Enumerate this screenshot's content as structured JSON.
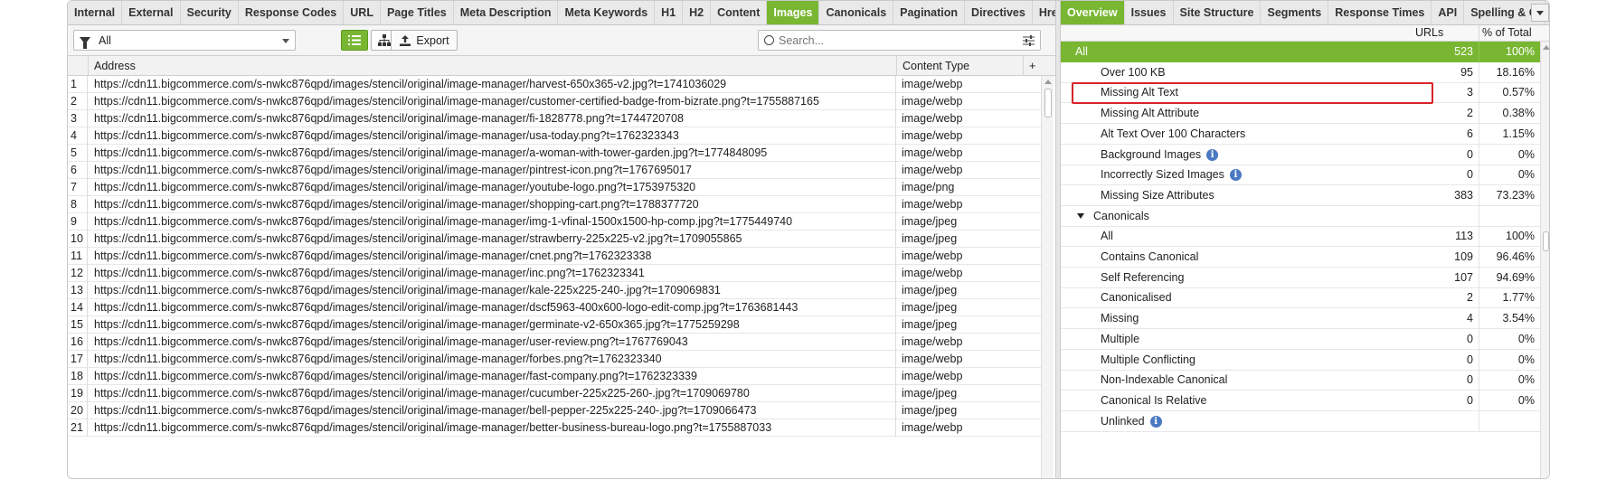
{
  "colors": {
    "accent": "#79b733",
    "highlight": "#d8232a",
    "info": "#4a78c2"
  },
  "left_tabs": [
    "Internal",
    "External",
    "Security",
    "Response Codes",
    "URL",
    "Page Titles",
    "Meta Description",
    "Meta Keywords",
    "H1",
    "H2",
    "Content",
    "Images",
    "Canonicals",
    "Pagination",
    "Directives",
    "Href"
  ],
  "left_active_tab": "Images",
  "toolbar": {
    "filter_value": "All",
    "export_label": "Export",
    "search_placeholder": "Search..."
  },
  "grid": {
    "columns": [
      "Address",
      "Content Type",
      "+"
    ],
    "rows": [
      {
        "n": "1",
        "address": "https://cdn11.bigcommerce.com/s-nwkc876qpd/images/stencil/original/image-manager/harvest-650x365-v2.jpg?t=1741036029",
        "type": "image/webp"
      },
      {
        "n": "2",
        "address": "https://cdn11.bigcommerce.com/s-nwkc876qpd/images/stencil/original/image-manager/customer-certified-badge-from-bizrate.png?t=1755887165",
        "type": "image/webp"
      },
      {
        "n": "3",
        "address": "https://cdn11.bigcommerce.com/s-nwkc876qpd/images/stencil/original/image-manager/fi-1828778.png?t=1744720708",
        "type": "image/webp"
      },
      {
        "n": "4",
        "address": "https://cdn11.bigcommerce.com/s-nwkc876qpd/images/stencil/original/image-manager/usa-today.png?t=1762323343",
        "type": "image/webp"
      },
      {
        "n": "5",
        "address": "https://cdn11.bigcommerce.com/s-nwkc876qpd/images/stencil/original/image-manager/a-woman-with-tower-garden.jpg?t=1774848095",
        "type": "image/webp"
      },
      {
        "n": "6",
        "address": "https://cdn11.bigcommerce.com/s-nwkc876qpd/images/stencil/original/image-manager/pintrest-icon.png?t=1767695017",
        "type": "image/webp"
      },
      {
        "n": "7",
        "address": "https://cdn11.bigcommerce.com/s-nwkc876qpd/images/stencil/original/image-manager/youtube-logo.png?t=1753975320",
        "type": "image/png"
      },
      {
        "n": "8",
        "address": "https://cdn11.bigcommerce.com/s-nwkc876qpd/images/stencil/original/image-manager/shopping-cart.png?t=1788377720",
        "type": "image/webp"
      },
      {
        "n": "9",
        "address": "https://cdn11.bigcommerce.com/s-nwkc876qpd/images/stencil/original/image-manager/img-1-vfinal-1500x1500-hp-comp.jpg?t=1775449740",
        "type": "image/jpeg"
      },
      {
        "n": "10",
        "address": "https://cdn11.bigcommerce.com/s-nwkc876qpd/images/stencil/original/image-manager/strawberry-225x225-v2.jpg?t=1709055865",
        "type": "image/jpeg"
      },
      {
        "n": "11",
        "address": "https://cdn11.bigcommerce.com/s-nwkc876qpd/images/stencil/original/image-manager/cnet.png?t=1762323338",
        "type": "image/webp"
      },
      {
        "n": "12",
        "address": "https://cdn11.bigcommerce.com/s-nwkc876qpd/images/stencil/original/image-manager/inc.png?t=1762323341",
        "type": "image/webp"
      },
      {
        "n": "13",
        "address": "https://cdn11.bigcommerce.com/s-nwkc876qpd/images/stencil/original/image-manager/kale-225x225-240-.jpg?t=1709069831",
        "type": "image/jpeg"
      },
      {
        "n": "14",
        "address": "https://cdn11.bigcommerce.com/s-nwkc876qpd/images/stencil/original/image-manager/dscf5963-400x600-logo-edit-comp.jpg?t=1763681443",
        "type": "image/jpeg"
      },
      {
        "n": "15",
        "address": "https://cdn11.bigcommerce.com/s-nwkc876qpd/images/stencil/original/image-manager/germinate-v2-650x365.jpg?t=1775259298",
        "type": "image/jpeg"
      },
      {
        "n": "16",
        "address": "https://cdn11.bigcommerce.com/s-nwkc876qpd/images/stencil/original/image-manager/user-review.png?t=1767769043",
        "type": "image/webp"
      },
      {
        "n": "17",
        "address": "https://cdn11.bigcommerce.com/s-nwkc876qpd/images/stencil/original/image-manager/forbes.png?t=1762323340",
        "type": "image/webp"
      },
      {
        "n": "18",
        "address": "https://cdn11.bigcommerce.com/s-nwkc876qpd/images/stencil/original/image-manager/fast-company.png?t=1762323339",
        "type": "image/webp"
      },
      {
        "n": "19",
        "address": "https://cdn11.bigcommerce.com/s-nwkc876qpd/images/stencil/original/image-manager/cucumber-225x225-260-.jpg?t=1709069780",
        "type": "image/jpeg"
      },
      {
        "n": "20",
        "address": "https://cdn11.bigcommerce.com/s-nwkc876qpd/images/stencil/original/image-manager/bell-pepper-225x225-240-.jpg?t=1709066473",
        "type": "image/jpeg"
      },
      {
        "n": "21",
        "address": "https://cdn11.bigcommerce.com/s-nwkc876qpd/images/stencil/original/image-manager/better-business-bureau-logo.png?t=1755887033",
        "type": "image/webp"
      }
    ]
  },
  "right_tabs": [
    "Overview",
    "Issues",
    "Site Structure",
    "Segments",
    "Response Times",
    "API",
    "Spelling & G"
  ],
  "right_active_tab": "Overview",
  "overview": {
    "col_urls": "URLs",
    "col_pct": "% of Total",
    "rows": [
      {
        "label": "All",
        "urls": "523",
        "pct": "100%",
        "level": "top",
        "selected": true
      },
      {
        "label": "Over 100 KB",
        "urls": "95",
        "pct": "18.16%",
        "level": "child"
      },
      {
        "label": "Missing Alt Text",
        "urls": "3",
        "pct": "0.57%",
        "level": "child"
      },
      {
        "label": "Missing Alt Attribute",
        "urls": "2",
        "pct": "0.38%",
        "level": "child"
      },
      {
        "label": "Alt Text Over 100 Characters",
        "urls": "6",
        "pct": "1.15%",
        "level": "child"
      },
      {
        "label": "Background Images",
        "urls": "0",
        "pct": "0%",
        "level": "child",
        "info": true
      },
      {
        "label": "Incorrectly Sized Images",
        "urls": "0",
        "pct": "0%",
        "level": "child",
        "info": true
      },
      {
        "label": "Missing Size Attributes",
        "urls": "383",
        "pct": "73.23%",
        "level": "child"
      },
      {
        "label": "Canonicals",
        "urls": "",
        "pct": "",
        "level": "section"
      },
      {
        "label": "All",
        "urls": "113",
        "pct": "100%",
        "level": "child"
      },
      {
        "label": "Contains Canonical",
        "urls": "109",
        "pct": "96.46%",
        "level": "child"
      },
      {
        "label": "Self Referencing",
        "urls": "107",
        "pct": "94.69%",
        "level": "child"
      },
      {
        "label": "Canonicalised",
        "urls": "2",
        "pct": "1.77%",
        "level": "child"
      },
      {
        "label": "Missing",
        "urls": "4",
        "pct": "3.54%",
        "level": "child"
      },
      {
        "label": "Multiple",
        "urls": "0",
        "pct": "0%",
        "level": "child"
      },
      {
        "label": "Multiple Conflicting",
        "urls": "0",
        "pct": "0%",
        "level": "child"
      },
      {
        "label": "Non-Indexable Canonical",
        "urls": "0",
        "pct": "0%",
        "level": "child"
      },
      {
        "label": "Canonical Is Relative",
        "urls": "0",
        "pct": "0%",
        "level": "child"
      },
      {
        "label": "Unlinked",
        "urls": "",
        "pct": "",
        "level": "child",
        "info": true
      }
    ]
  },
  "icons": {
    "filter": "funnel-icon",
    "list_view": "list-view-icon",
    "tree_view": "tree-view-icon",
    "export": "export-icon",
    "search": "search-icon",
    "search_options": "sliders-icon",
    "info": "info-icon"
  }
}
